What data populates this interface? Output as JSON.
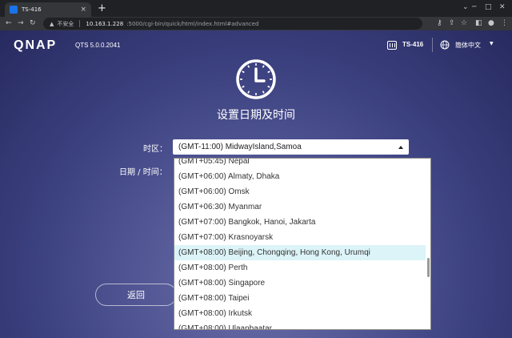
{
  "browser": {
    "tab_title": "TS-416",
    "tab_close": "×",
    "new_tab": "+",
    "insecure_label": "不安全",
    "url_host": "10.163.1.228",
    "url_path": ":5000/cgi-bin/quick/html/index.html#advanced"
  },
  "header": {
    "logo": "QNAP",
    "version": "QTS 5.0.0.2041",
    "device_name": "TS-416",
    "language": "簡体中文"
  },
  "main": {
    "heading": "设置日期及时间",
    "timezone_label": "时区：",
    "timezone_value": "(GMT-11:00) MidwayIsland,Samoa",
    "datetime_label": "日期 / 时间：",
    "back_button": "返回"
  },
  "dropdown": {
    "options": [
      "(GMT+05:45) Nepal",
      "(GMT+06:00) Almaty, Dhaka",
      "(GMT+06:00) Omsk",
      "(GMT+06:30) Myanmar",
      "(GMT+07:00) Bangkok, Hanoi, Jakarta",
      "(GMT+07:00) Krasnoyarsk",
      "(GMT+08:00) Beijing, Chongqing, Hong Kong, Urumqi",
      "(GMT+08:00) Perth",
      "(GMT+08:00) Singapore",
      "(GMT+08:00) Taipei",
      "(GMT+08:00) Irkutsk",
      "(GMT+08:00) Ulaanbaatar"
    ],
    "highlighted": "(GMT+08:00) Beijing, Chongqing, Hong Kong, Urumqi"
  },
  "colors": {
    "highlight": "#dcf4f8",
    "page_bg": "#3c4180"
  }
}
